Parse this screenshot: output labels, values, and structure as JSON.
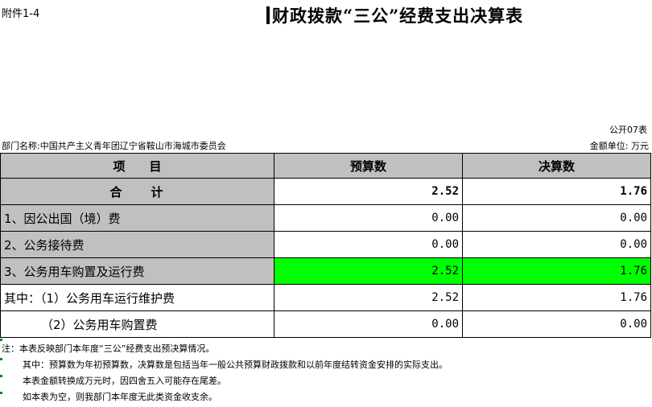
{
  "attachment_label": "附件1-4",
  "title": "财政拨款“三公”经费支出决算表",
  "form_number": "公开07表",
  "department": "部门名称:中国共产主义青年团辽宁省鞍山市海城市委员会",
  "unit": "金额单位: 万元",
  "table": {
    "headers": [
      "项　　目",
      "预算数",
      "决算数"
    ],
    "total": {
      "label": "合　　计",
      "budget": "2.52",
      "final": "1.76"
    },
    "rows": [
      {
        "label": "1、因公出国（境）费",
        "budget": "0.00",
        "final": "0.00"
      },
      {
        "label": "2、公务接待费",
        "budget": "0.00",
        "final": "0.00"
      },
      {
        "label": "3、公务用车购置及运行费",
        "budget": "2.52",
        "final": "1.76"
      },
      {
        "label": "其中：（1）公务用车运行维护费",
        "budget": "2.52",
        "final": "1.76"
      },
      {
        "label": "（2）公务用车购置费",
        "budget": "0.00",
        "final": "0.00"
      }
    ]
  },
  "notes": [
    "注：本表反映部门本年度“三公”经费支出预决算情况。",
    "其中：预算数为年初预算数，决算数是包括当年一般公共预算财政拨款和以前年度结转资金安排的实际支出。",
    "本表金额转换成万元时，因四舍五入可能存在尾差。",
    "如本表为空，则我部门本年度无此类资金收支余。"
  ],
  "colors": {
    "header_bg": "#c0c0c0",
    "highlight_bg": "#00ff00"
  }
}
